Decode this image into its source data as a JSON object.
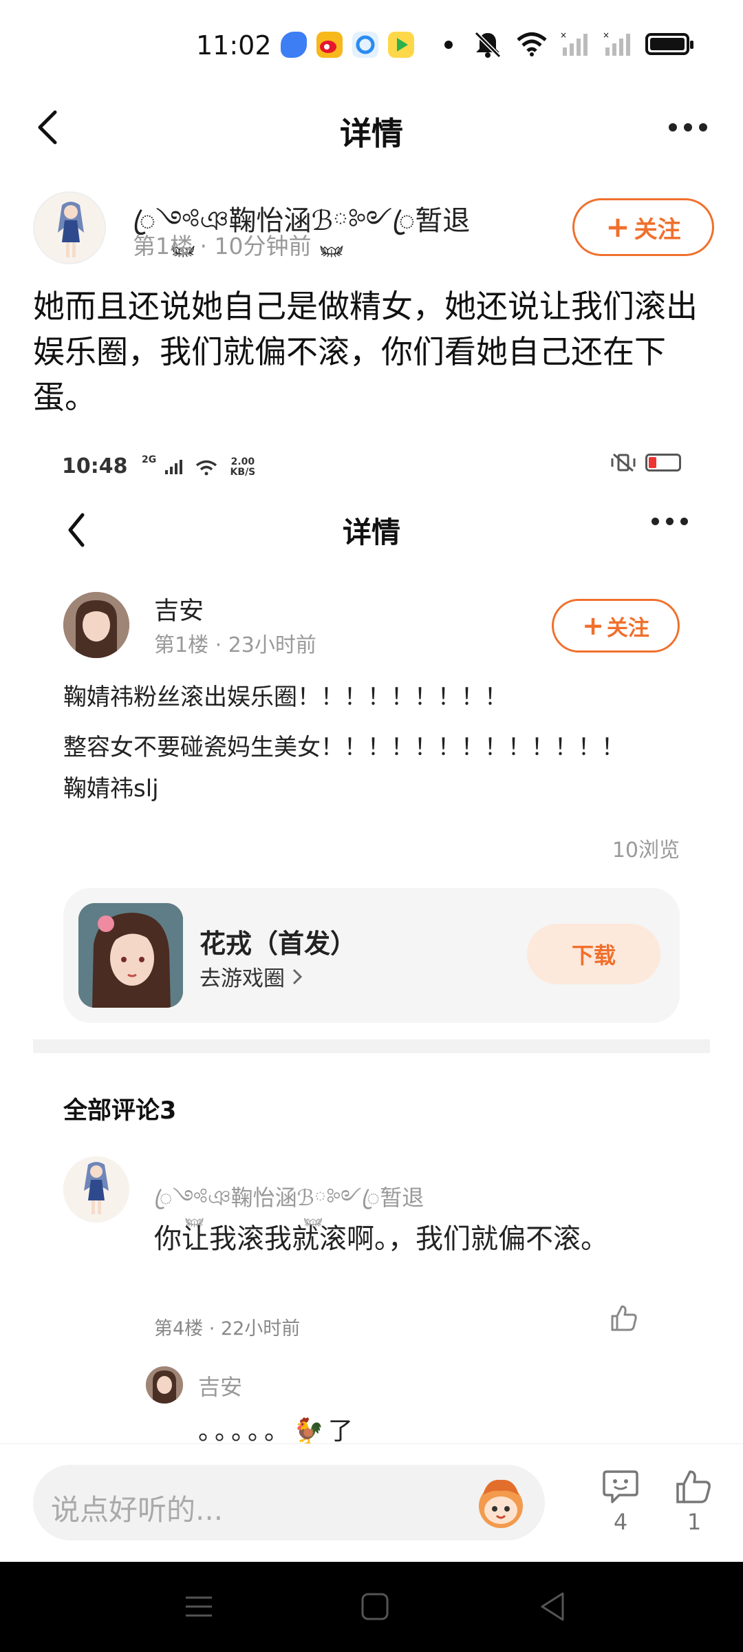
{
  "status_bar": {
    "time": "11:02",
    "icons": [
      "blue-app-icon",
      "weibo-icon",
      "browser-icon",
      "game-icon",
      "dot",
      "mute-icon",
      "wifi-icon",
      "signal-icon",
      "signal-icon",
      "battery-icon"
    ]
  },
  "header": {
    "title": "详情"
  },
  "post": {
    "author_name": "ꦿ༺࿆ঞ鞠怡涵ℬ࿆༻ꦿ暂退",
    "floor": "第1楼",
    "time": "10分钟前",
    "follow_label": "关注",
    "text": "她而且还说她自己是做精女，她还说让我们滚出娱乐圈，我们就偏不滚，你们看她自己还在下蛋。"
  },
  "embedded": {
    "status_time": "10:48",
    "status_extra": "2G",
    "net_speed": "2.00",
    "net_unit": "KB/S",
    "title": "详情",
    "author_name": "吉安",
    "floor": "第1楼",
    "time": "23小时前",
    "follow_label": "关注",
    "lines": [
      "鞠婧祎粉丝滚出娱乐圈！！！！！！！！！",
      "整容女不要碰瓷妈生美女！！！！！！！！！！！！！",
      "鞠婧祎slj"
    ],
    "views": "10浏览",
    "game": {
      "name": "花戎（首发）",
      "link": "去游戏圈",
      "download_label": "下载"
    },
    "comments_title": "全部评论3",
    "comment": {
      "author": "ꦿ༺࿆ঞ鞠怡涵ℬ࿆༻ꦿ暂退",
      "text": "你让我滚我就滚啊。，我们就偏不滚。",
      "floor": "第4楼",
      "time": "22小时前"
    },
    "reply": {
      "author": "吉安",
      "text": "。。。。。🐓了"
    }
  },
  "input_bar": {
    "placeholder": "说点好听的...",
    "comment_count": "4",
    "like_count": "1"
  },
  "colors": {
    "accent": "#f0702c",
    "download_bg": "#fde8dc",
    "muted": "#999999"
  }
}
